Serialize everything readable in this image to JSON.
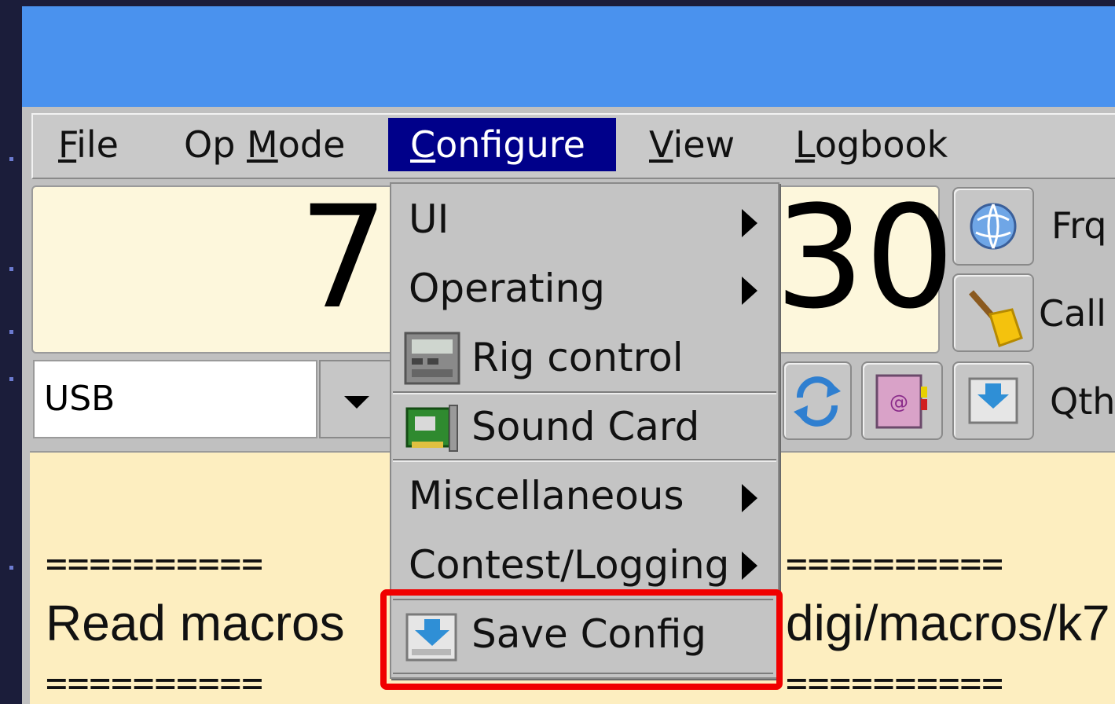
{
  "menubar": {
    "file": {
      "pre": "",
      "ul": "F",
      "post": "ile"
    },
    "opmode": {
      "pre": "Op ",
      "ul": "M",
      "post": "ode"
    },
    "configure": {
      "pre": "",
      "ul": "C",
      "post": "onfigure"
    },
    "view": {
      "pre": "",
      "ul": "V",
      "post": "iew"
    },
    "logbook": {
      "pre": "",
      "ul": "L",
      "post": "ogbook"
    }
  },
  "frequency": {
    "left_digit": "7",
    "right_digits": "30"
  },
  "side": {
    "frq_label": "Frq",
    "call_label": "Call",
    "qth_label": "Qth"
  },
  "mode": {
    "value": "USB"
  },
  "rx": {
    "line1_left": "==========",
    "line1_right": "==========",
    "text_left": "Read macros",
    "text_right": "digi/macros/k7",
    "line2_left": "==========",
    "line2_right": "=========="
  },
  "configure_menu": {
    "items": [
      {
        "label": "UI",
        "submenu": true
      },
      {
        "label": "Operating",
        "submenu": true
      },
      {
        "label": "Rig control",
        "icon": "rig-icon"
      },
      {
        "label": "Sound Card",
        "icon": "sound-card-icon"
      },
      {
        "label": "Miscellaneous",
        "submenu": true
      },
      {
        "label": "Contest/Logging",
        "submenu": true
      },
      {
        "label": "Save Config",
        "icon": "save-config-icon"
      }
    ]
  },
  "colors": {
    "title_bar": "#4a92ee",
    "menu_active": "#00008a",
    "freq_bg": "#fdf7dc",
    "rx_bg": "#fdeec0",
    "highlight": "#f00000"
  }
}
